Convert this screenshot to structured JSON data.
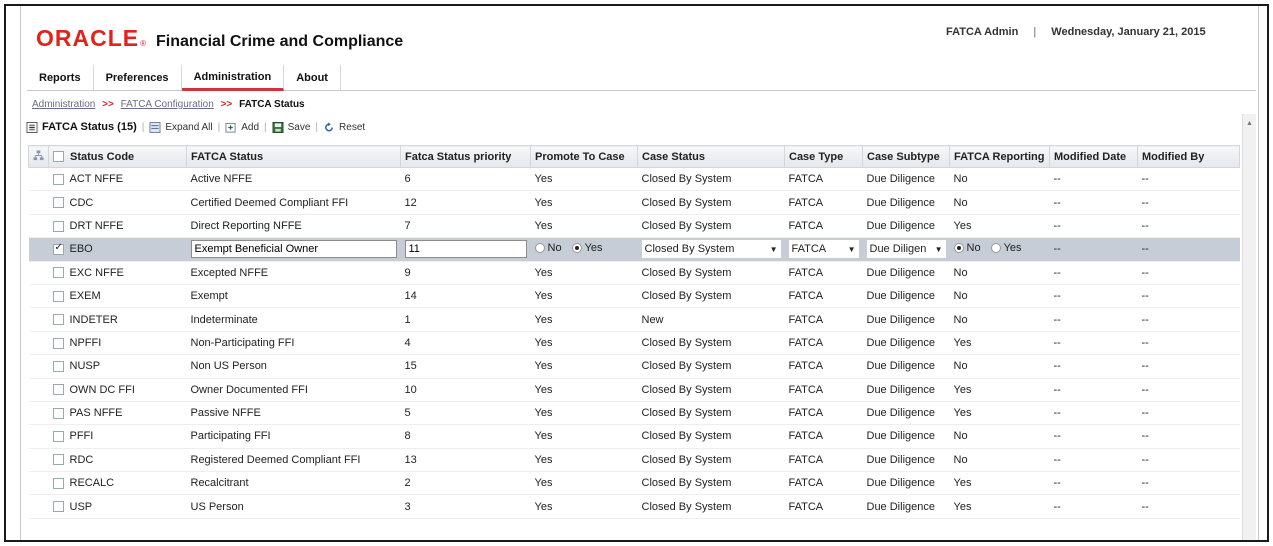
{
  "header": {
    "logo_text": "ORACLE",
    "logo_reg": "®",
    "product_name": "Financial Crime and Compliance",
    "user": "FATCA Admin",
    "separator": "|",
    "date": "Wednesday, January 21, 2015"
  },
  "tabs": [
    {
      "label": "Reports",
      "active": false
    },
    {
      "label": "Preferences",
      "active": false
    },
    {
      "label": "Administration",
      "active": true
    },
    {
      "label": "About",
      "active": false
    }
  ],
  "breadcrumb": {
    "items": [
      "Administration",
      "FATCA Configuration"
    ],
    "separator": ">>",
    "current": "FATCA Status"
  },
  "toolbar": {
    "title": "FATCA Status (15)",
    "expand_all": "Expand All",
    "add": "Add",
    "save": "Save",
    "reset": "Reset"
  },
  "grid": {
    "columns": [
      "Status Code",
      "FATCA Status",
      "Fatca Status priority",
      "Promote To Case",
      "Case Status",
      "Case Type",
      "Case Subtype",
      "FATCA Reporting",
      "Modified Date",
      "Modified By"
    ],
    "rows": [
      {
        "code": "ACT NFFE",
        "status": "Active NFFE",
        "priority": "6",
        "promote": "Yes",
        "case_status": "Closed By System",
        "case_type": "FATCA",
        "subtype": "Due Diligence",
        "reporting": "No",
        "mdate": "--",
        "mby": "--"
      },
      {
        "code": "CDC",
        "status": "Certified Deemed Compliant FFI",
        "priority": "12",
        "promote": "Yes",
        "case_status": "Closed By System",
        "case_type": "FATCA",
        "subtype": "Due Diligence",
        "reporting": "No",
        "mdate": "--",
        "mby": "--"
      },
      {
        "code": "DRT NFFE",
        "status": "Direct Reporting NFFE",
        "priority": "7",
        "promote": "Yes",
        "case_status": "Closed By System",
        "case_type": "FATCA",
        "subtype": "Due Diligence",
        "reporting": "Yes",
        "mdate": "--",
        "mby": "--"
      },
      {
        "code": "EBO",
        "status": "Exempt Beneficial Owner",
        "priority": "11",
        "promote": "Yes",
        "case_status": "Closed By System",
        "case_type": "FATCA",
        "subtype": "Due Diligen",
        "reporting": "No",
        "mdate": "--",
        "mby": "--",
        "selected": true
      },
      {
        "code": "EXC NFFE",
        "status": "Excepted NFFE",
        "priority": "9",
        "promote": "Yes",
        "case_status": "Closed By System",
        "case_type": "FATCA",
        "subtype": "Due Diligence",
        "reporting": "No",
        "mdate": "--",
        "mby": "--"
      },
      {
        "code": "EXEM",
        "status": "Exempt",
        "priority": "14",
        "promote": "Yes",
        "case_status": "Closed By System",
        "case_type": "FATCA",
        "subtype": "Due Diligence",
        "reporting": "No",
        "mdate": "--",
        "mby": "--"
      },
      {
        "code": "INDETER",
        "status": "Indeterminate",
        "priority": "1",
        "promote": "Yes",
        "case_status": "New",
        "case_type": "FATCA",
        "subtype": "Due Diligence",
        "reporting": "No",
        "mdate": "--",
        "mby": "--"
      },
      {
        "code": "NPFFI",
        "status": "Non-Participating FFI",
        "priority": "4",
        "promote": "Yes",
        "case_status": "Closed By System",
        "case_type": "FATCA",
        "subtype": "Due Diligence",
        "reporting": "Yes",
        "mdate": "--",
        "mby": "--"
      },
      {
        "code": "NUSP",
        "status": "Non US Person",
        "priority": "15",
        "promote": "Yes",
        "case_status": "Closed By System",
        "case_type": "FATCA",
        "subtype": "Due Diligence",
        "reporting": "No",
        "mdate": "--",
        "mby": "--"
      },
      {
        "code": "OWN DC FFI",
        "status": "Owner Documented FFI",
        "priority": "10",
        "promote": "Yes",
        "case_status": "Closed By System",
        "case_type": "FATCA",
        "subtype": "Due Diligence",
        "reporting": "Yes",
        "mdate": "--",
        "mby": "--"
      },
      {
        "code": "PAS NFFE",
        "status": "Passive NFFE",
        "priority": "5",
        "promote": "Yes",
        "case_status": "Closed By System",
        "case_type": "FATCA",
        "subtype": "Due Diligence",
        "reporting": "Yes",
        "mdate": "--",
        "mby": "--"
      },
      {
        "code": "PFFI",
        "status": "Participating FFI",
        "priority": "8",
        "promote": "Yes",
        "case_status": "Closed By System",
        "case_type": "FATCA",
        "subtype": "Due Diligence",
        "reporting": "No",
        "mdate": "--",
        "mby": "--"
      },
      {
        "code": "RDC",
        "status": "Registered Deemed Compliant FFI",
        "priority": "13",
        "promote": "Yes",
        "case_status": "Closed By System",
        "case_type": "FATCA",
        "subtype": "Due Diligence",
        "reporting": "No",
        "mdate": "--",
        "mby": "--"
      },
      {
        "code": "RECALC",
        "status": "Recalcitrant",
        "priority": "2",
        "promote": "Yes",
        "case_status": "Closed By System",
        "case_type": "FATCA",
        "subtype": "Due Diligence",
        "reporting": "Yes",
        "mdate": "--",
        "mby": "--"
      },
      {
        "code": "USP",
        "status": "US Person",
        "priority": "3",
        "promote": "Yes",
        "case_status": "Closed By System",
        "case_type": "FATCA",
        "subtype": "Due Diligence",
        "reporting": "Yes",
        "mdate": "--",
        "mby": "--"
      }
    ],
    "radio_no": "No",
    "radio_yes": "Yes"
  },
  "colors": {
    "brand_red": "#e2231a",
    "selected_row": "#c7cdd6",
    "tab_active_underline": "#d2323c"
  },
  "icons": {
    "expand": "expand-all-icon",
    "add": "add-icon",
    "save": "save-icon",
    "reset": "reset-icon"
  }
}
